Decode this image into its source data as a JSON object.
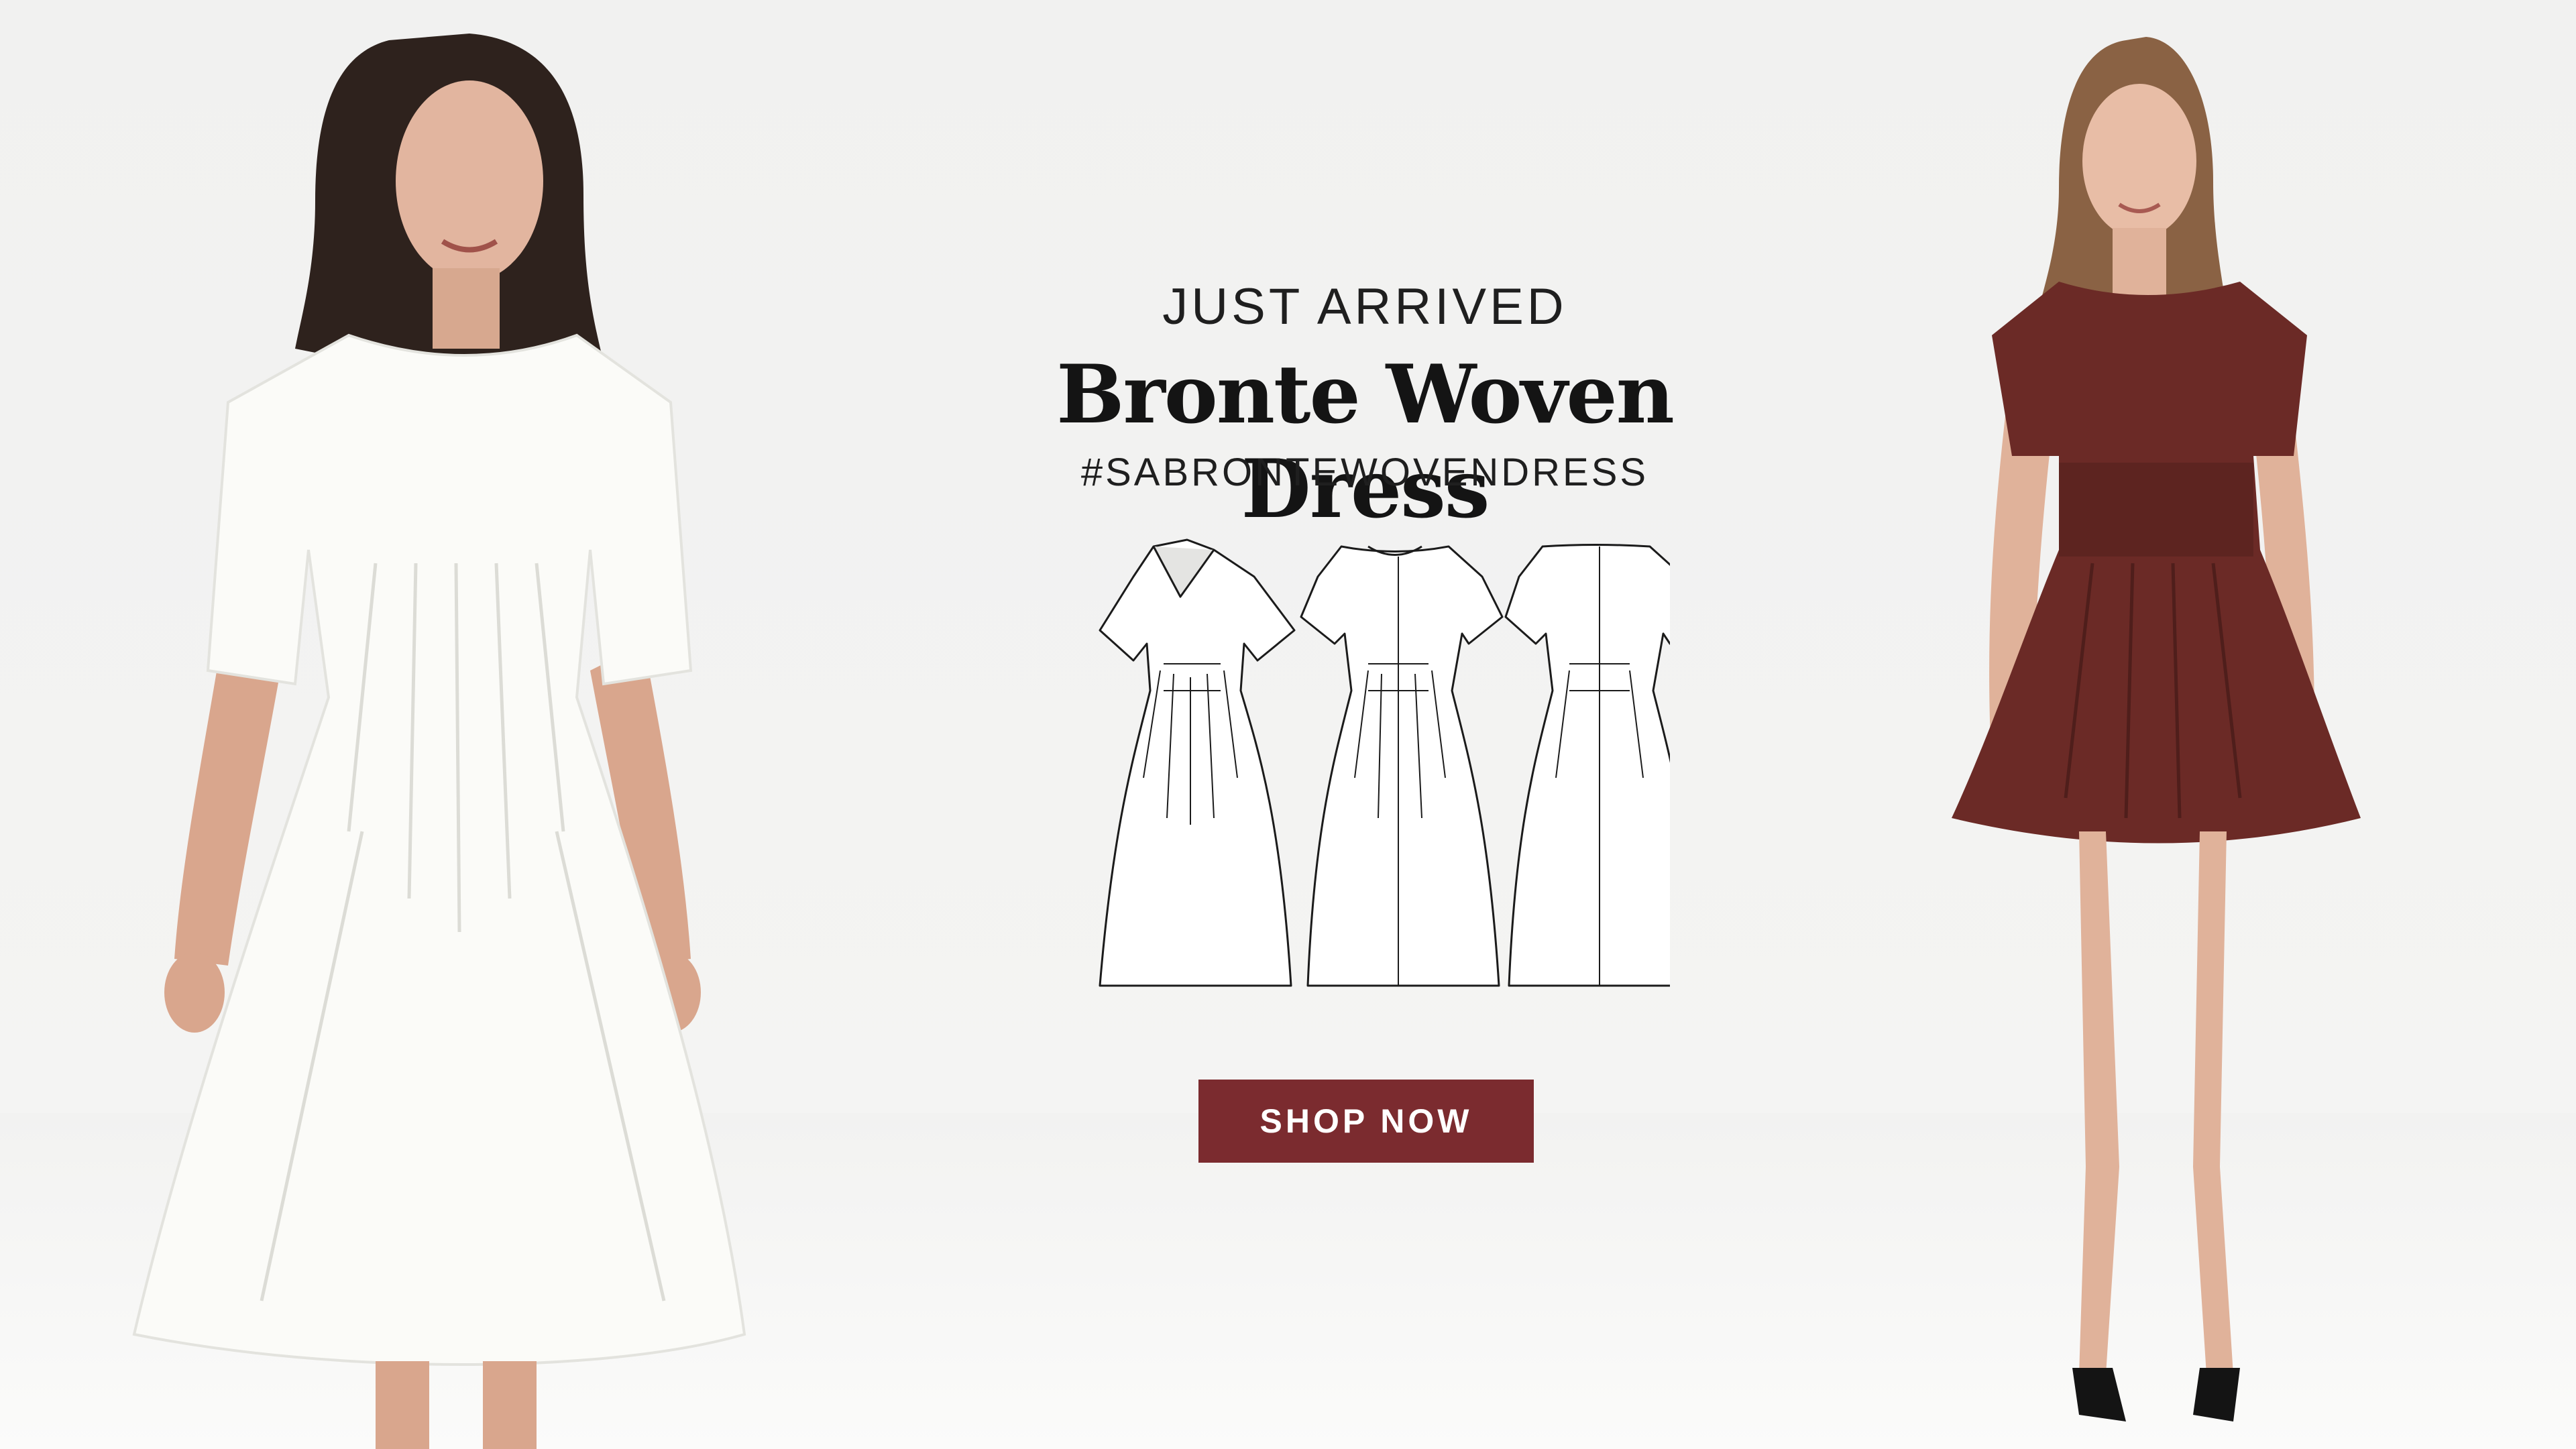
{
  "hero": {
    "eyebrow": "JUST ARRIVED",
    "title": "Bronte Woven Dress",
    "hashtag": "#SABRONTEWOVENDRESS",
    "cta_label": "SHOP NOW"
  },
  "colors": {
    "accent": "#7b2b2f",
    "background": "#f2f2f1",
    "text": "#141414",
    "dress_white": "#fbfbf8",
    "dress_burgundy": "#6b2a26"
  },
  "images": {
    "left_model": "woman-in-white-midi-dress",
    "right_model": "woman-in-burgundy-mini-dress",
    "sketches": [
      "dress-front-v-neck-sketch",
      "dress-front-round-neck-sketch",
      "dress-back-sketch"
    ]
  }
}
